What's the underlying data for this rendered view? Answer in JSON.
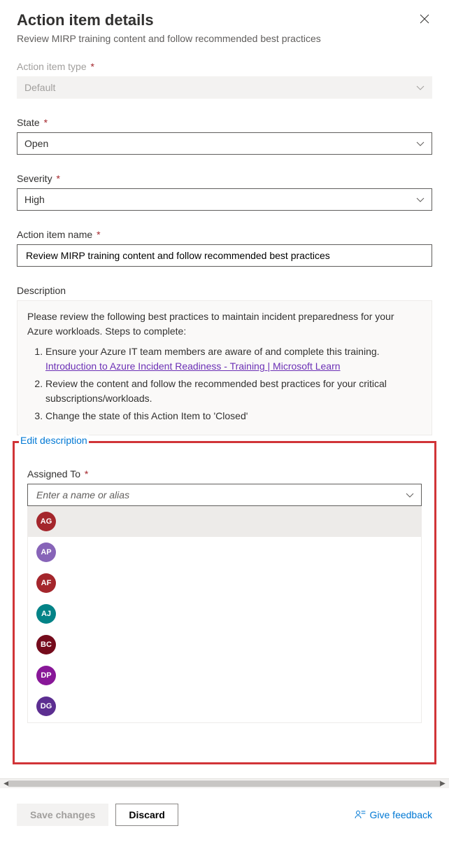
{
  "header": {
    "title": "Action item details",
    "subtitle": "Review MIRP training content and follow recommended best practices"
  },
  "fields": {
    "type": {
      "label": "Action item type",
      "value": "Default"
    },
    "state": {
      "label": "State",
      "value": "Open"
    },
    "severity": {
      "label": "Severity",
      "value": "High"
    },
    "name": {
      "label": "Action item name",
      "value": "Review MIRP training content and follow recommended best practices"
    },
    "description": {
      "label": "Description",
      "intro": "Please review the following best practices to maintain incident preparedness for your Azure workloads. Steps to complete:",
      "steps": [
        "Ensure your Azure IT team members are aware of and complete this training.",
        "Review the content and follow the recommended best practices for your critical subscriptions/workloads.",
        "Change the state of this Action Item to 'Closed'"
      ],
      "link_text": "Introduction to Azure Incident Readiness - Training | Microsoft Learn",
      "edit_link": "Edit description"
    },
    "assigned": {
      "label": "Assigned To",
      "placeholder": "Enter a name or alias"
    }
  },
  "people": [
    {
      "initials": "AG",
      "color": "#a4262c",
      "selected": true
    },
    {
      "initials": "AP",
      "color": "#8764b8",
      "selected": false
    },
    {
      "initials": "AF",
      "color": "#a4262c",
      "selected": false
    },
    {
      "initials": "AJ",
      "color": "#038387",
      "selected": false
    },
    {
      "initials": "BC",
      "color": "#750b1c",
      "selected": false
    },
    {
      "initials": "DP",
      "color": "#881798",
      "selected": false
    },
    {
      "initials": "DG",
      "color": "#5c2e91",
      "selected": false
    },
    {
      "initials": "",
      "color": "#00b294",
      "selected": false
    }
  ],
  "footer": {
    "save": "Save changes",
    "discard": "Discard",
    "feedback": "Give feedback"
  }
}
